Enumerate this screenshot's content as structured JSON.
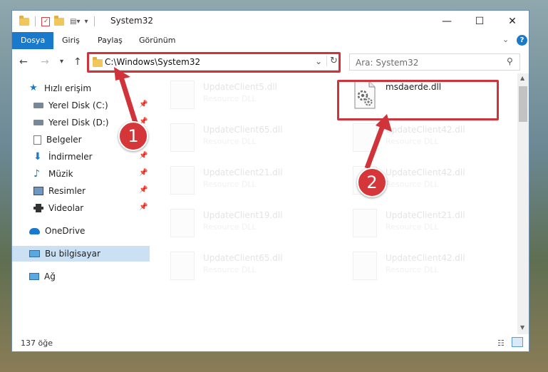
{
  "window": {
    "title": "System32",
    "minimize": "—",
    "maximize": "☐",
    "close": "✕"
  },
  "ribbon": {
    "tabs": [
      {
        "label": "Dosya",
        "active": true
      },
      {
        "label": "Giriş",
        "active": false
      },
      {
        "label": "Paylaş",
        "active": false
      },
      {
        "label": "Görünüm",
        "active": false
      }
    ]
  },
  "navbar": {
    "address": "C:\\Windows\\System32",
    "search_placeholder": "Ara: System32"
  },
  "sidebar": {
    "items": [
      {
        "label": "Hızlı erişim",
        "icon": "star-icon"
      },
      {
        "label": "Yerel Disk (C:)",
        "icon": "drive-icon",
        "pinned": true
      },
      {
        "label": "Yerel Disk (D:)",
        "icon": "drive-icon",
        "pinned": true
      },
      {
        "label": "Belgeler",
        "icon": "documents-icon"
      },
      {
        "label": "İndirmeler",
        "icon": "downloads-icon",
        "pinned": true
      },
      {
        "label": "Müzik",
        "icon": "music-icon",
        "pinned": true
      },
      {
        "label": "Resimler",
        "icon": "pictures-icon",
        "pinned": true
      },
      {
        "label": "Videolar",
        "icon": "videos-icon",
        "pinned": true
      },
      {
        "label": "OneDrive",
        "icon": "cloud-icon"
      },
      {
        "label": "Bu bilgisayar",
        "icon": "computer-icon",
        "selected": true
      },
      {
        "label": "Ağ",
        "icon": "network-icon"
      }
    ]
  },
  "files": [
    {
      "name": "UpdateClient5.dll",
      "type": "Resource DLL",
      "faded": true
    },
    {
      "name": "msdaerde.dll",
      "type": "",
      "faded": false
    },
    {
      "name": "UpdateClient65.dll",
      "type": "Resource DLL",
      "faded": true
    },
    {
      "name": "UpdateClient42.dll",
      "type": "Resource DLL",
      "faded": true
    },
    {
      "name": "UpdateClient21.dll",
      "type": "Resource DLL",
      "faded": true
    },
    {
      "name": "UpdateClient42.dll",
      "type": "Resource DLL",
      "faded": true
    },
    {
      "name": "UpdateClient19.dll",
      "type": "Resource DLL",
      "faded": true
    },
    {
      "name": "UpdateClient21.dll",
      "type": "Resource DLL",
      "faded": true
    },
    {
      "name": "UpdateClient65.dll",
      "type": "Resource DLL",
      "faded": true
    },
    {
      "name": "UpdateClient42.dll",
      "type": "Resource DLL",
      "faded": true
    }
  ],
  "status": {
    "count": "137 öğe"
  },
  "annotations": {
    "step1": "1",
    "step2": "2",
    "color": "#d0343a"
  }
}
